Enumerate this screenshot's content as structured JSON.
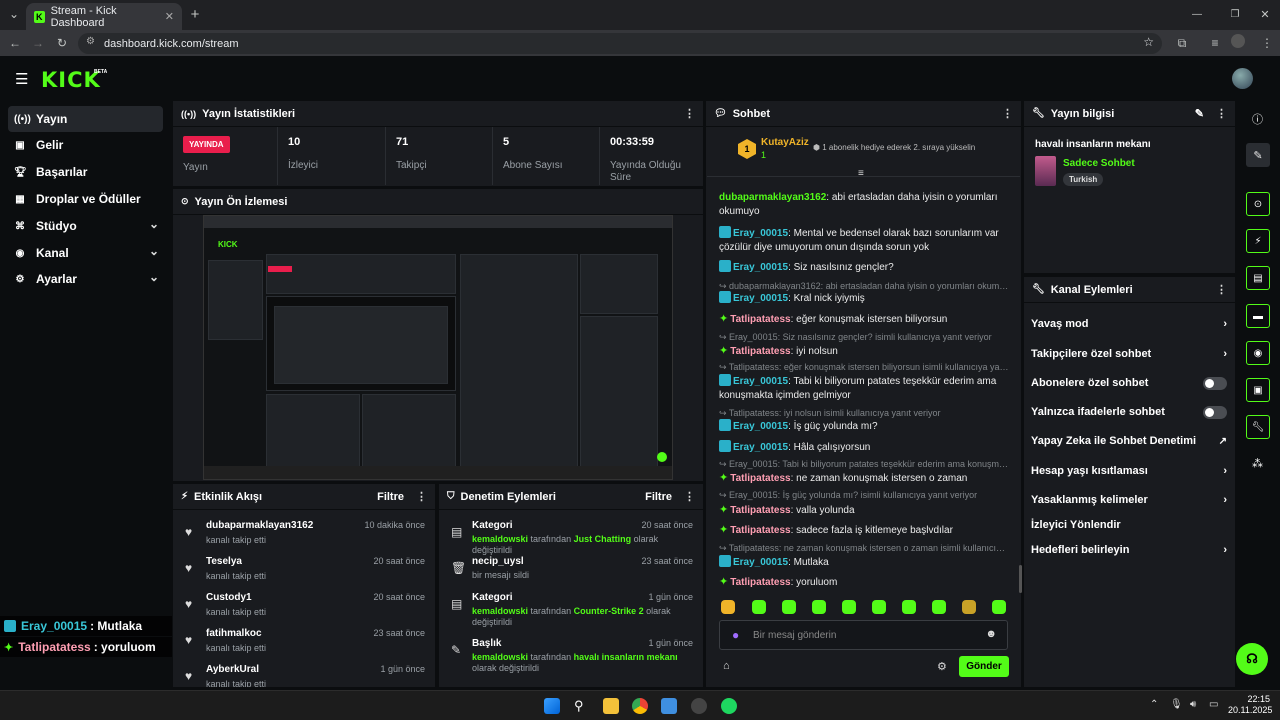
{
  "browser": {
    "tab_title": "Stream - Kick Dashboard",
    "url": "dashboard.kick.com/stream"
  },
  "header": {
    "logo": "KICK",
    "beta": "BETA"
  },
  "sidebar": {
    "items": [
      {
        "label": "Yayın",
        "icon": "broadcast-icon",
        "active": true
      },
      {
        "label": "Gelir",
        "icon": "wallet-icon"
      },
      {
        "label": "Başarılar",
        "icon": "trophy-icon"
      },
      {
        "label": "Droplar ve Ödüller",
        "icon": "gift-icon"
      },
      {
        "label": "Stüdyo",
        "icon": "studio-icon",
        "expandable": true
      },
      {
        "label": "Kanal",
        "icon": "channel-icon",
        "expandable": true
      },
      {
        "label": "Ayarlar",
        "icon": "gear-icon",
        "expandable": true
      }
    ]
  },
  "stats": {
    "title": "Yayın İstatistikleri",
    "live_badge": "YAYINDA",
    "live_label": "Yayın",
    "viewers_value": "10",
    "viewers_label": "İzleyici",
    "followers_value": "71",
    "followers_label": "Takipçi",
    "subs_value": "5",
    "subs_label": "Abone Sayısı",
    "uptime_value": "00:33:59",
    "uptime_label": "Yayında Olduğu Süre"
  },
  "preview": {
    "title": "Yayın Ön İzlemesi"
  },
  "activity": {
    "title": "Etkinlik Akışı",
    "filter": "Filtre",
    "items": [
      {
        "name": "dubaparmaklayan3162",
        "sub": "kanalı takip etti",
        "time": "10 dakika önce"
      },
      {
        "name": "Teselya",
        "sub": "kanalı takip etti",
        "time": "20 saat önce"
      },
      {
        "name": "Custody1",
        "sub": "kanalı takip etti",
        "time": "20 saat önce"
      },
      {
        "name": "fatihmalkoc",
        "sub": "kanalı takip etti",
        "time": "23 saat önce"
      },
      {
        "name": "AyberkUral",
        "sub": "kanalı takip etti",
        "time": "1 gün önce"
      }
    ]
  },
  "moderation": {
    "title": "Denetim Eylemleri",
    "filter": "Filtre",
    "items": [
      {
        "name": "Kategori",
        "time": "20 saat önce",
        "actor": "kemaldowski",
        "mid": "tarafından",
        "target": "Just Chatting",
        "end": "olarak değiştirildi"
      },
      {
        "name": "necip_uysl",
        "time": "23 saat önce",
        "plain": "bir mesajı sildi"
      },
      {
        "name": "Kategori",
        "time": "1 gün önce",
        "actor": "kemaldowski",
        "mid": "tarafından",
        "target": "Counter-Strike 2",
        "end": "olarak değiştirildi"
      },
      {
        "name": "Başlık",
        "time": "1 gün önce",
        "actor": "kemaldowski",
        "mid": "tarafından",
        "target": "havalı insanların mekanı",
        "end": "olarak değiştirildi"
      }
    ]
  },
  "chat": {
    "title": "Sohbet",
    "pinned_user": "KutayAziz",
    "pinned_count": "1",
    "pinned_text": "1 abonelik hediye ederek 2. sıraya yükselin",
    "messages": [
      {
        "type": "msg",
        "user": "dubaparmaklayan3162",
        "color": "green",
        "text": "abi ertasladan daha iyisin o yorumları okumuyo"
      },
      {
        "type": "msg",
        "user": "Eray_00015",
        "color": "blue",
        "badge": true,
        "text": "Mental ve bedensel olarak bazı sorunlarım var çözülür diye umuyorum onun dışında sorun yok"
      },
      {
        "type": "msg",
        "user": "Eray_00015",
        "color": "blue",
        "badge": true,
        "text": "Siz nasılsınız gençler?"
      },
      {
        "type": "reply",
        "text": "dubaparmaklayan3162: abi ertasladan daha iyisin o yorumları okumuyo..."
      },
      {
        "type": "msg",
        "user": "Eray_00015",
        "color": "blue",
        "badge": true,
        "text": "Kral nick iyiymiş"
      },
      {
        "type": "msg",
        "user": "Tatlipatatess",
        "color": "pink",
        "spark": true,
        "text": "eğer konuşmak istersen biliyorsun"
      },
      {
        "type": "reply",
        "text": "Eray_00015: Siz nasılsınız gençler? isimli kullanıcıya yanıt veriyor"
      },
      {
        "type": "msg",
        "user": "Tatlipatatess",
        "color": "pink",
        "spark": true,
        "text": "iyi nolsun"
      },
      {
        "type": "reply",
        "text": "Tatlipatatess: eğer konuşmak istersen biliyorsun isimli kullanıcıya yanıt..."
      },
      {
        "type": "msg",
        "user": "Eray_00015",
        "color": "blue",
        "badge": true,
        "text": "Tabi ki biliyorum patates teşekkür ederim ama konuşmakta içimden gelmiyor"
      },
      {
        "type": "reply",
        "text": "Tatlipatatess: iyi nolsun isimli kullanıcıya yanıt veriyor"
      },
      {
        "type": "msg",
        "user": "Eray_00015",
        "color": "blue",
        "badge": true,
        "text": "İş güç yolunda mı?"
      },
      {
        "type": "msg",
        "user": "Eray_00015",
        "color": "blue",
        "badge": true,
        "text": "Hâla çalışıyorsun"
      },
      {
        "type": "reply",
        "text": "Eray_00015: Tabi ki biliyorum patates teşekkür ederim ama konuşmakt..."
      },
      {
        "type": "msg",
        "user": "Tatlipatatess",
        "color": "pink",
        "spark": true,
        "text": "ne zaman konuşmak istersen o zaman"
      },
      {
        "type": "reply",
        "text": "Eray_00015: İş güç yolunda mı? isimli kullanıcıya yanıt veriyor"
      },
      {
        "type": "msg",
        "user": "Tatlipatatess",
        "color": "pink",
        "spark": true,
        "text": "valla yolunda"
      },
      {
        "type": "msg",
        "user": "Tatlipatatess",
        "color": "pink",
        "spark": true,
        "text": "sadece fazla iş kitlemeye başlvdılar"
      },
      {
        "type": "reply",
        "text": "Tatlipatatess: ne zaman konuşmak istersen o zaman isimli kullanıcıya ..."
      },
      {
        "type": "msg",
        "user": "Eray_00015",
        "color": "blue",
        "badge": true,
        "text": "Mutlaka"
      },
      {
        "type": "msg",
        "user": "Tatlipatatess",
        "color": "pink",
        "spark": true,
        "text": "yoruluom"
      }
    ],
    "input_placeholder": "Bir mesaj gönderin",
    "send": "Gönder"
  },
  "stream_info": {
    "title": "Yayın bilgisi",
    "stream_title": "havalı insanların mekanı",
    "category": "Sadece Sohbet",
    "tag": "Turkish"
  },
  "channel_actions": {
    "title": "Kanal Eylemleri",
    "items": [
      {
        "label": "Yavaş mod",
        "ctrl": "chevron"
      },
      {
        "label": "Takipçilere özel sohbet",
        "ctrl": "chevron"
      },
      {
        "label": "Abonelere özel sohbet",
        "ctrl": "toggle"
      },
      {
        "label": "Yalnızca ifadelerle sohbet",
        "ctrl": "toggle"
      },
      {
        "label": "Yapay Zeka ile Sohbet Denetimi",
        "ctrl": "external"
      },
      {
        "label": "Hesap yaşı kısıtlaması",
        "ctrl": "chevron"
      },
      {
        "label": "Yasaklanmış kelimeler",
        "ctrl": "chevron"
      },
      {
        "label": "İzleyici Yönlendir",
        "ctrl": "none"
      },
      {
        "label": "Hedefleri belirleyin",
        "ctrl": "chevron"
      }
    ]
  },
  "overlay": {
    "line1_user": "Eray_00015",
    "line1_text": ": Mutlaka",
    "line2_user": "Tatlipatatess",
    "line2_text": ": yoruluom"
  },
  "taskbar": {
    "time": "22:15",
    "date": "20.11.2025"
  },
  "colors": {
    "accent": "#53fc18",
    "live": "#e91e4c",
    "panel": "#191b1f",
    "bg": "#0b0d0f"
  }
}
